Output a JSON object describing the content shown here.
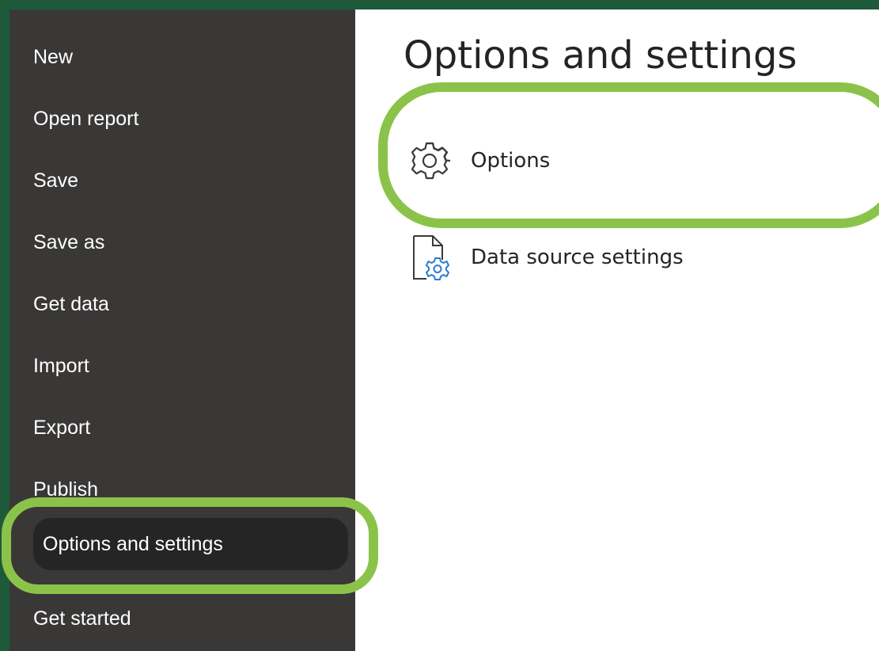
{
  "sidebar": {
    "items": [
      {
        "label": "New"
      },
      {
        "label": "Open report"
      },
      {
        "label": "Save"
      },
      {
        "label": "Save as"
      },
      {
        "label": "Get data"
      },
      {
        "label": "Import"
      },
      {
        "label": "Export"
      },
      {
        "label": "Publish"
      },
      {
        "label": "Options and settings",
        "selected": true
      },
      {
        "label": "Get started"
      }
    ]
  },
  "main": {
    "title": "Options and settings",
    "options": [
      {
        "label": "Options",
        "icon": "gear-icon"
      },
      {
        "label": "Data source settings",
        "icon": "data-source-settings-icon"
      }
    ]
  },
  "colors": {
    "outer_frame": "#1e5a3a",
    "sidebar_bg": "#3a3837",
    "sidebar_selected_bg": "#262525",
    "highlight": "#8bc34a",
    "icon_blue": "#2b7cd3"
  }
}
